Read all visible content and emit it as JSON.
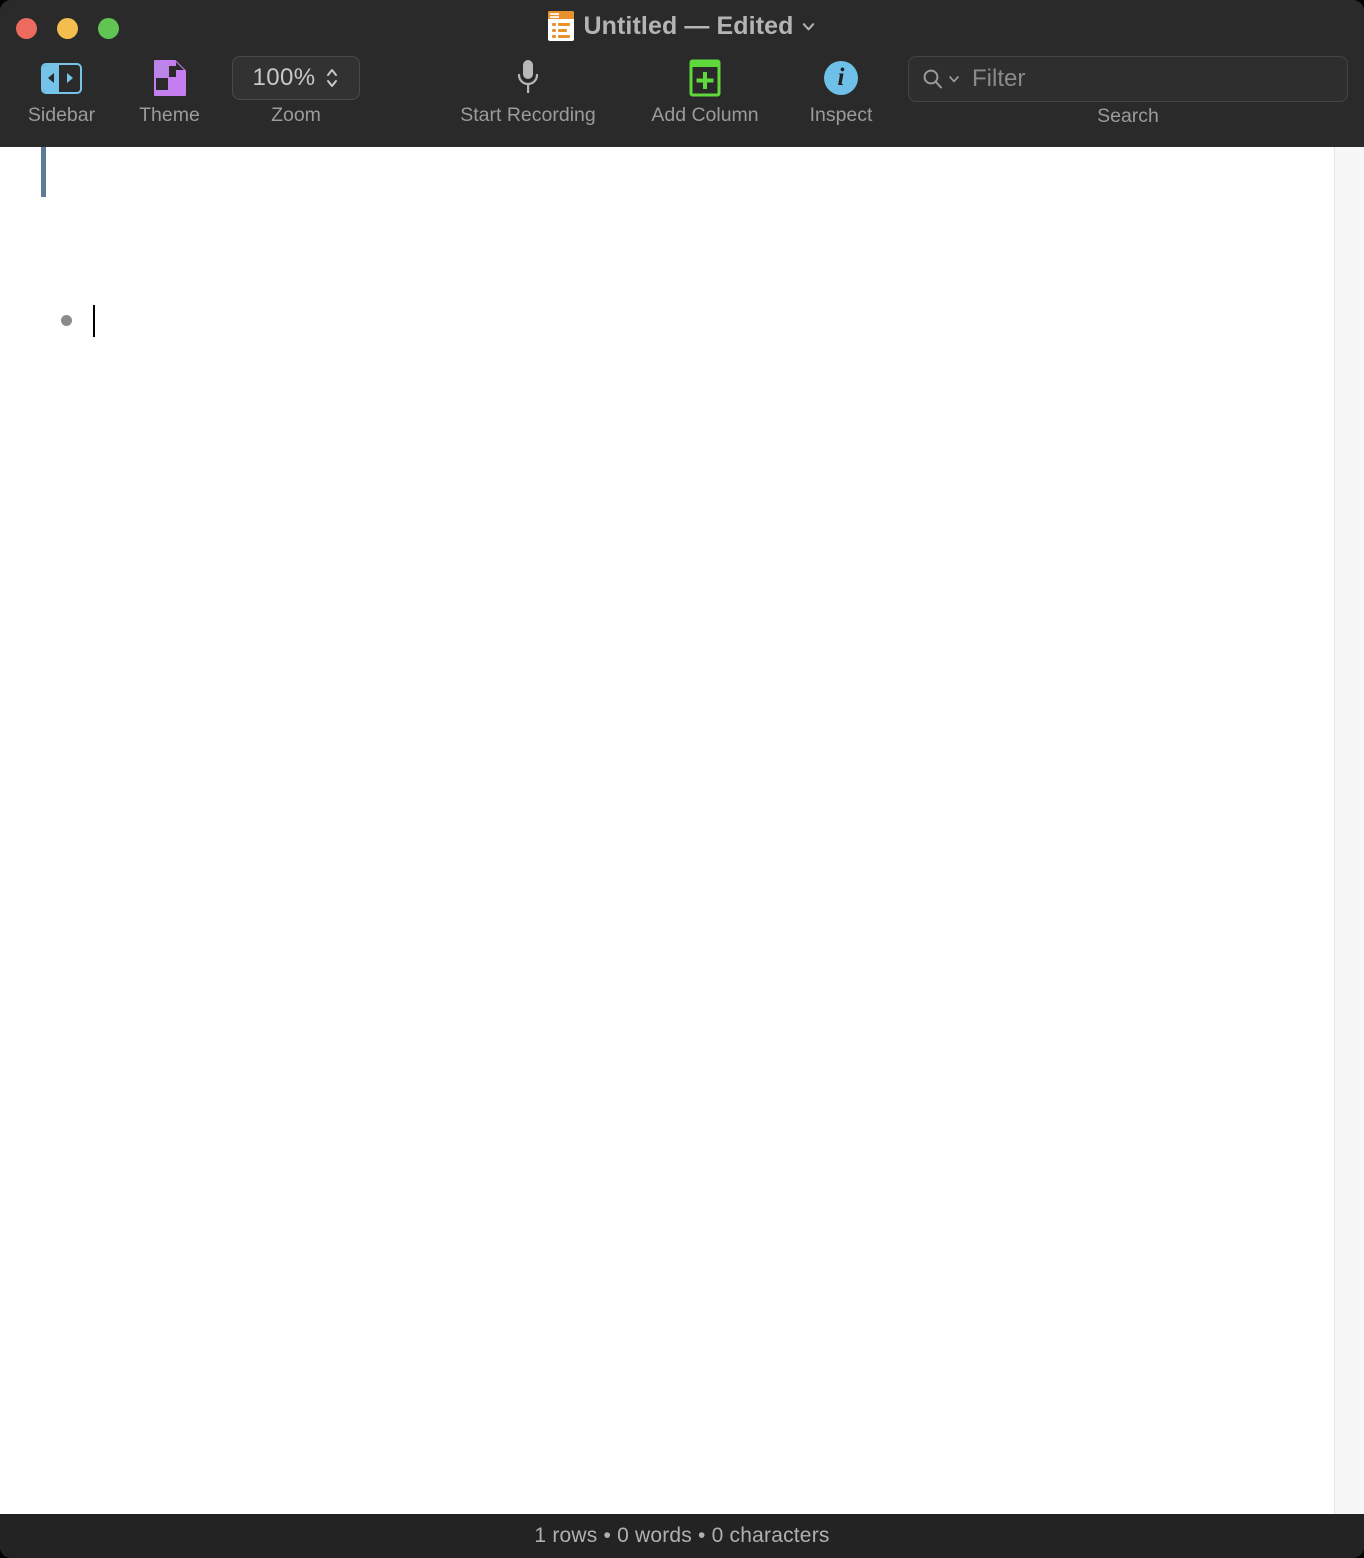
{
  "window": {
    "title": "Untitled — Edited",
    "app_icon": "document-outline-icon",
    "title_chevron": "chevron-down-icon",
    "traffic_lights": {
      "close": "close-button",
      "minimize": "minimize-button",
      "maximize": "maximize-button",
      "close_color": "#ed6a5e",
      "minimize_color": "#f4bd4f",
      "maximize_color": "#61c554"
    }
  },
  "toolbar": {
    "items": [
      {
        "id": "sidebar",
        "label": "Sidebar",
        "icon": "sidebar-toggle-icon"
      },
      {
        "id": "theme",
        "label": "Theme",
        "icon": "theme-document-icon"
      },
      {
        "id": "zoom",
        "label": "Zoom",
        "icon": "stepper-icon",
        "value": "100%"
      },
      {
        "id": "start-recording",
        "label": "Start Recording",
        "icon": "microphone-icon"
      },
      {
        "id": "add-column",
        "label": "Add Column",
        "icon": "add-column-icon"
      },
      {
        "id": "inspect",
        "label": "Inspect",
        "icon": "info-circle-icon"
      }
    ],
    "search": {
      "label": "Search",
      "placeholder": "Filter",
      "value": "",
      "icon": "search-icon",
      "menu_icon": "chevron-down-icon"
    },
    "colors": {
      "sidebar_icon": "#76c3ea",
      "theme_icon": "#c57ef0",
      "add_column_icon": "#5fd83c",
      "inspect_icon": "#6fc0e8",
      "label": "#9b9b9b",
      "toolbar_bg": "#2a2a2a"
    }
  },
  "document": {
    "rows": [
      {
        "bullet": "•",
        "text": ""
      }
    ],
    "caret_visible": true
  },
  "statusbar": {
    "text": "1 rows • 0 words • 0 characters"
  }
}
